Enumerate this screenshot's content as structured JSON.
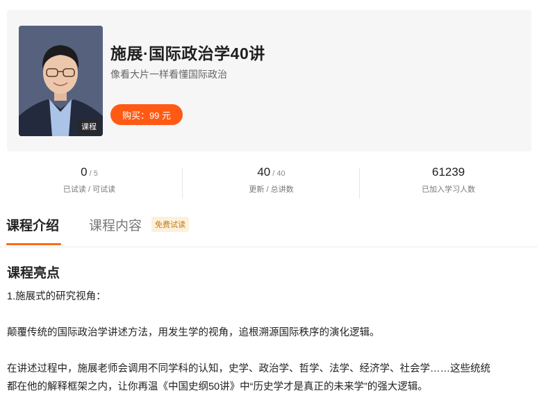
{
  "course": {
    "title": "施展·国际政治学40讲",
    "subtitle": "像看大片一样看懂国际政治",
    "buy_label": "购买：99 元",
    "cover_badge": "课程"
  },
  "stats": [
    {
      "value": "0",
      "suffix": " / 5",
      "label": "已试读 / 可试读"
    },
    {
      "value": "40",
      "suffix": " / 40",
      "label": "更新 / 总讲数"
    },
    {
      "value": "61239",
      "suffix": "",
      "label": "已加入学习人数"
    }
  ],
  "tabs": {
    "intro": "课程介绍",
    "content": "课程内容",
    "badge": "免费试读"
  },
  "section": {
    "title": "课程亮点",
    "paragraphs": [
      "1.施展式的研究视角：",
      "颠覆传统的国际政治学讲述方法，用发生学的视角，追根溯源国际秩序的演化逻辑。",
      "在讲述过程中，施展老师会调用不同学科的认知，史学、政治学、哲学、法学、经济学、社会学……这些统统",
      "都在他的解释框架之内，让你再温《中国史纲50讲》中“历史学才是真正的未来学”的强大逻辑。"
    ]
  },
  "colors": {
    "accent": "#ff5a14",
    "badge_bg": "#fdf1dc",
    "badge_text": "#c07a14"
  }
}
